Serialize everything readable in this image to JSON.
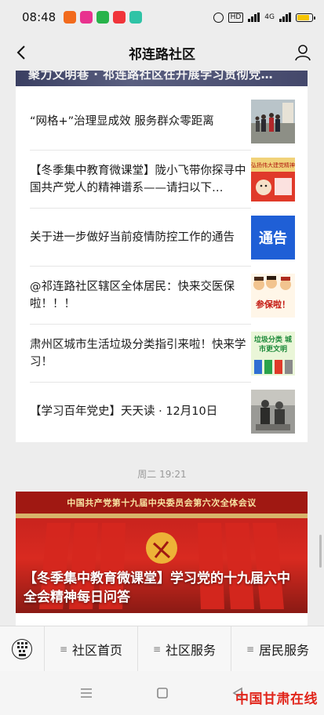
{
  "status": {
    "time": "08:48",
    "net_tag": "HD",
    "signal_label": "4G"
  },
  "header": {
    "title": "祁连路社区"
  },
  "articles_card": {
    "top_title": "聚力文明巷 · 祁连路社区在开展学习贯彻党…",
    "items": [
      {
        "title": "“网格+”治理显成效  服务群众零距离",
        "thumb": "people-outdoor-photo"
      },
      {
        "title": "【冬季集中教育微课堂】陇小飞带你探寻中国共产党人的精神谱系——请扫以下…",
        "thumb": "party-spirit-poster"
      },
      {
        "title": "关于进一步做好当前疫情防控工作的通告",
        "thumb": "notice-thumb",
        "thumb_text": "通告"
      },
      {
        "title": "@祁连路社区辖区全体居民：快来交医保啦！！！",
        "thumb": "insurance-thumb",
        "thumb_text": "参保啦！"
      },
      {
        "title": "肃州区城市生活垃圾分类指引来啦！快来学习！",
        "thumb": "garbage-sorting-thumb",
        "thumb_text": "垃圾分类 城市更文明"
      },
      {
        "title": "【学习百年党史】天天读 · 12月10日",
        "thumb": "history-photo"
      }
    ]
  },
  "timestamp": "周二 19:21",
  "banner": {
    "top_text": "中国共产党第十九届中央委员会第六次全体会议",
    "title": "【冬季集中教育微课堂】学习党的十九届六中全会精神每日问答"
  },
  "bottom_menu": {
    "items": [
      "社区首页",
      "社区服务",
      "居民服务"
    ]
  },
  "watermark": "中国甘肃在线",
  "colors": {
    "background": "#ededed",
    "card": "#ffffff",
    "notice_blue": "#1f5fd6",
    "party_red": "#c8231e",
    "watermark_red": "#e1251b"
  }
}
